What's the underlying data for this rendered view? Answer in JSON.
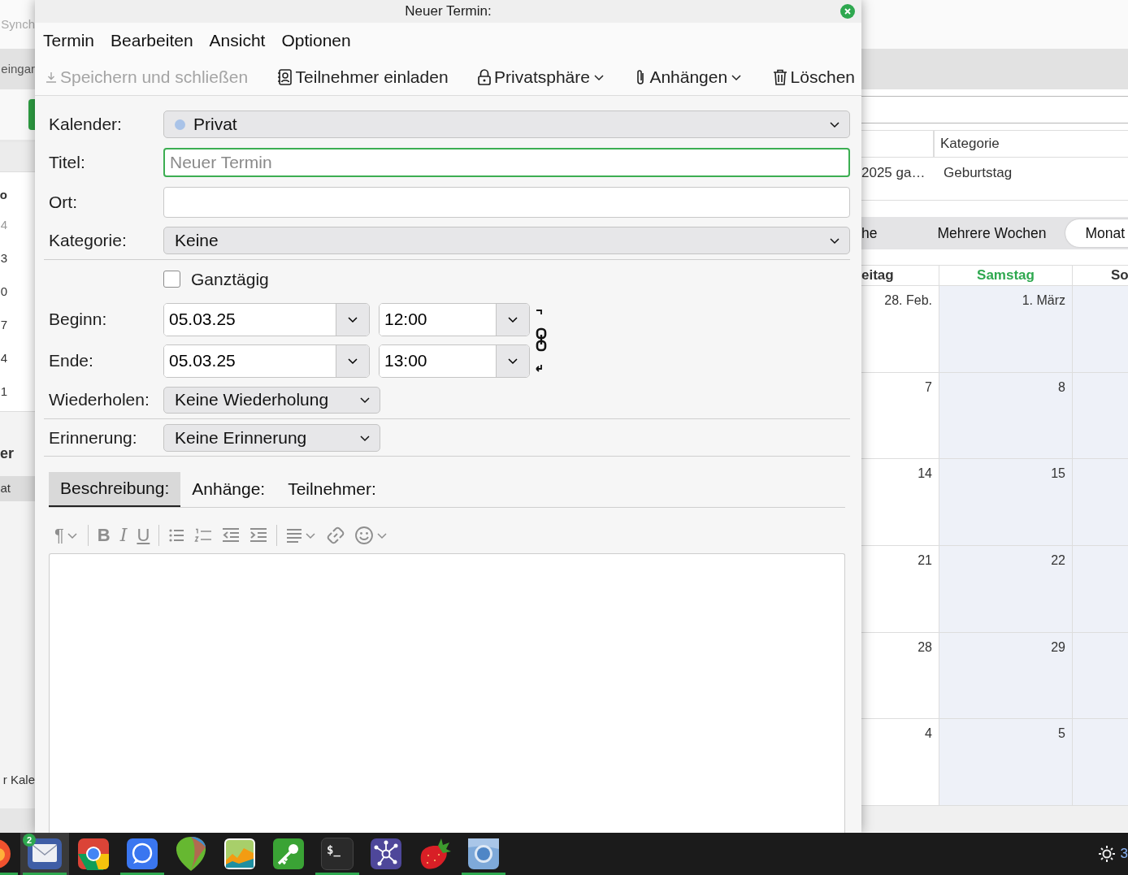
{
  "background_app": {
    "left_pane": {
      "top_text": "Synch",
      "tab_text": "eingar",
      "minicalendar": {
        "header": "o",
        "days": [
          {
            "label": "4",
            "dimmed": true
          },
          {
            "label": "3",
            "dimmed": false
          },
          {
            "label": "0",
            "dimmed": false
          },
          {
            "label": "7",
            "dimmed": false
          },
          {
            "label": "4",
            "dimmed": false
          },
          {
            "label": "1",
            "dimmed": false
          }
        ]
      },
      "section_heading": "er",
      "items": [
        {
          "label": "at",
          "selected": true
        }
      ],
      "footer_text": "r Kale"
    },
    "event_list": {
      "columns": [
        {},
        {
          "label": "Kategorie"
        }
      ],
      "rows": [
        {
          "cells": [
            "2025 ga…",
            "Geburtstag"
          ]
        }
      ]
    },
    "view_tabs": [
      {
        "label": "he",
        "selected": false
      },
      {
        "label": "Mehrere Wochen",
        "selected": false
      },
      {
        "label": "Monat",
        "selected": true
      }
    ],
    "month_view": {
      "day_headers": [
        {
          "label": "eitag",
          "highlighted": false
        },
        {
          "label": "Samstag",
          "highlighted": true
        },
        {
          "label": "So",
          "highlighted": false
        }
      ],
      "weeks": [
        {
          "days": [
            {
              "label": "28. Feb.",
              "weekend": false
            },
            {
              "label": "1. März",
              "weekend": true
            },
            {
              "weekend": true
            }
          ]
        },
        {
          "days": [
            {
              "label": "7",
              "weekend": false
            },
            {
              "label": "8",
              "weekend": true
            },
            {
              "weekend": true
            }
          ]
        },
        {
          "days": [
            {
              "label": "14",
              "weekend": false
            },
            {
              "label": "15",
              "weekend": true
            },
            {
              "weekend": true
            }
          ]
        },
        {
          "days": [
            {
              "label": "21",
              "weekend": false
            },
            {
              "label": "22",
              "weekend": true
            },
            {
              "weekend": true
            }
          ]
        },
        {
          "days": [
            {
              "label": "28",
              "weekend": false
            },
            {
              "label": "29",
              "weekend": true
            },
            {
              "weekend": true
            }
          ]
        },
        {
          "days": [
            {
              "label": "4",
              "weekend": false
            },
            {
              "label": "5",
              "weekend": true
            },
            {
              "weekend": true
            }
          ]
        }
      ]
    }
  },
  "dialog": {
    "title": "Neuer Termin:",
    "menu": [
      {
        "label": "Termin"
      },
      {
        "label": "Bearbeiten"
      },
      {
        "label": "Ansicht"
      },
      {
        "label": "Optionen"
      }
    ],
    "toolbar": [
      {
        "kind": "save",
        "label": "Speichern und schließen",
        "disabled": true,
        "dropdown": false
      },
      {
        "kind": "invite",
        "label": "Teilnehmer einladen",
        "disabled": false,
        "dropdown": false
      },
      {
        "kind": "privacy",
        "label": "Privatsphäre",
        "disabled": false,
        "dropdown": true
      },
      {
        "kind": "attach",
        "label": "Anhängen",
        "disabled": false,
        "dropdown": true
      },
      {
        "kind": "delete",
        "label": "Löschen",
        "disabled": false,
        "dropdown": false
      }
    ],
    "form": {
      "calendar": {
        "label": "Kalender:",
        "value": "Privat",
        "color": "#a9c3e8"
      },
      "title": {
        "label": "Titel:",
        "placeholder": "Neuer Termin",
        "focused": true
      },
      "location": {
        "label": "Ort:"
      },
      "category": {
        "label": "Kategorie:",
        "value": "Keine"
      },
      "all_day": {
        "label": "Ganztägig",
        "checked": false
      },
      "start": {
        "label": "Beginn:",
        "date": "05.03.25",
        "time": "12:00"
      },
      "end": {
        "label": "Ende:",
        "date": "05.03.25",
        "time": "13:00"
      },
      "times_linked": true,
      "repeat": {
        "label": "Wiederholen:",
        "value": "Keine Wiederholung"
      },
      "reminder": {
        "label": "Erinnerung:",
        "value": "Keine Erinnerung"
      }
    },
    "tabs": [
      {
        "label": "Beschreibung:",
        "selected": true
      },
      {
        "label": "Anhänge:",
        "selected": false
      },
      {
        "label": "Teilnehmer:",
        "selected": false
      }
    ],
    "editor_toolbar": [
      {
        "kind": "paragraph",
        "glyph": "¶",
        "disabled": true
      },
      {
        "kind": "separator"
      },
      {
        "kind": "bold",
        "glyph": "B",
        "disabled": true
      },
      {
        "kind": "italic",
        "glyph": "I",
        "disabled": true
      },
      {
        "kind": "underline",
        "glyph": "U",
        "disabled": true
      },
      {
        "kind": "separator"
      },
      {
        "kind": "bullets",
        "disabled": true
      },
      {
        "kind": "numbers",
        "disabled": true
      },
      {
        "kind": "outdent",
        "disabled": true
      },
      {
        "kind": "indent",
        "disabled": true
      },
      {
        "kind": "separator"
      },
      {
        "kind": "align",
        "disabled": true
      },
      {
        "kind": "link",
        "disabled": true
      },
      {
        "kind": "emoji",
        "disabled": true
      }
    ]
  },
  "taskbar": {
    "apps": [
      {
        "kind": "flame",
        "running": true,
        "selected": false
      },
      {
        "kind": "mail",
        "running": true,
        "selected": true,
        "badge": "2"
      },
      {
        "kind": "chrome",
        "running": false,
        "selected": false
      },
      {
        "kind": "chat",
        "running": true,
        "selected": false
      },
      {
        "kind": "leaf",
        "running": false,
        "selected": false
      },
      {
        "kind": "chart",
        "running": false,
        "selected": false
      },
      {
        "kind": "key",
        "running": false,
        "selected": false
      },
      {
        "kind": "terminal",
        "running": true,
        "selected": false,
        "prompt": "$_"
      },
      {
        "kind": "network",
        "running": false,
        "selected": false
      },
      {
        "kind": "strawberry",
        "running": false,
        "selected": false
      },
      {
        "kind": "globe",
        "running": true,
        "selected": false
      }
    ],
    "tray": {
      "brightness_text": "3"
    }
  }
}
